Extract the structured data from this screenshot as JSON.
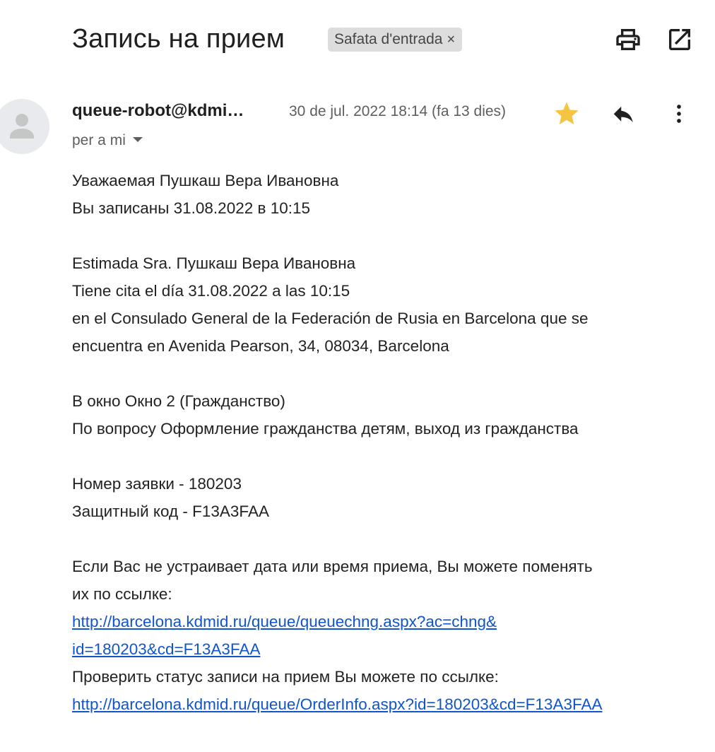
{
  "subject": "Запись на прием",
  "label_chip": {
    "label": "Safata d'entrada",
    "close": "×"
  },
  "toolbar": {
    "print_icon": "print-icon",
    "popout_icon": "open-in-new-window-icon"
  },
  "message": {
    "sender": "queue-robot@kdmi…",
    "date": "30 de jul. 2022 18:14 (fa 13 dies)",
    "recipient": "per a mi",
    "starred": true,
    "star_color": "#f4c542"
  },
  "body": {
    "ru_greeting": "Уважаемая Пушкаш Вера Ивановна",
    "ru_booked": "Вы записаны 31.08.2022 в 10:15",
    "es_greeting": "Estimada Sra. Пушкаш Вера Ивановна",
    "es_booked": "Tiene cita el día 31.08.2022 a las 10:15",
    "es_place_1": "en el Consulado General de la Federación de Rusia en Barcelona que se",
    "es_place_2": "encuentra en Avenida Pearson, 34, 08034, Barcelona",
    "window": "В окно Окно 2 (Гражданство)",
    "topic": "По вопросу Оформление гражданства детям, выход из гражданства",
    "application_number": "Номер заявки - 180203",
    "security_code": "Защитный код - F13A3FAA",
    "change_text_1": "Если Вас не устраивает дата или время приема, Вы можете поменять",
    "change_text_2": "их по ссылке:",
    "change_link_1": "http://barcelona.kdmid.ru/queue/queuechng.aspx?ac=chng&",
    "change_link_2": "id=180203&cd=F13A3FAA",
    "status_text": "Проверить статус записи на прием Вы можете по ссылке:",
    "status_link": "http://barcelona.kdmid.ru/queue/OrderInfo.aspx?id=180203&cd=F13A3FAA",
    "link_color": "#1155cc"
  }
}
